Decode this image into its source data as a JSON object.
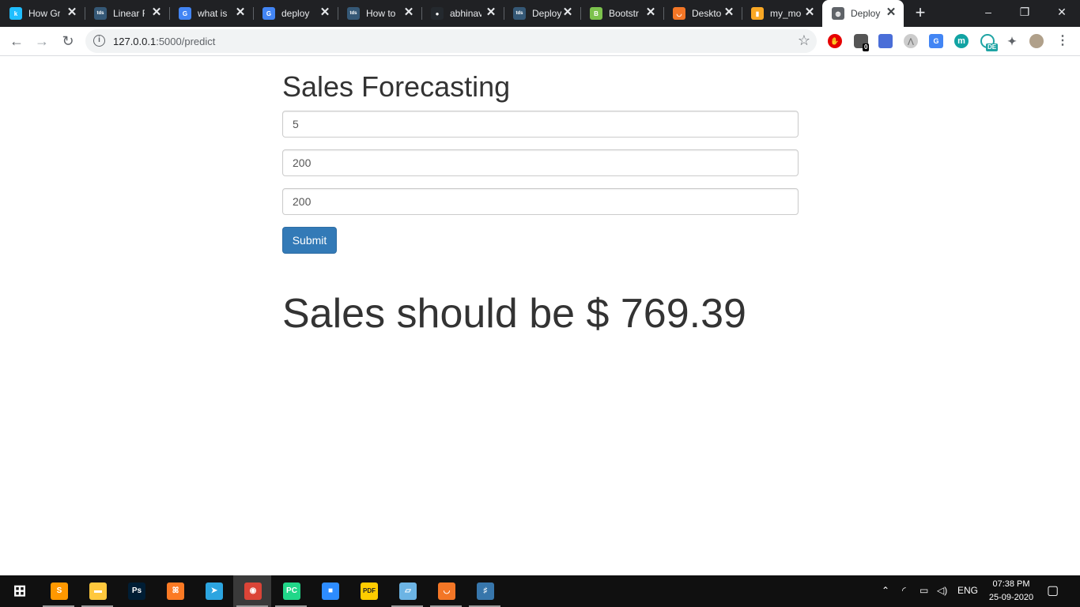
{
  "browser": {
    "tabs": [
      {
        "title": "How Gr",
        "icon": "kaggle-icon",
        "color": "#20beff"
      },
      {
        "title": "Linear R",
        "icon": "tds-icon",
        "color": "#355876"
      },
      {
        "title": "what is",
        "icon": "google-icon",
        "color": "#4285f4"
      },
      {
        "title": "deploy",
        "icon": "google-icon",
        "color": "#4285f4"
      },
      {
        "title": "How to",
        "icon": "tds-icon",
        "color": "#355876"
      },
      {
        "title": "abhinav",
        "icon": "github-icon",
        "color": "#24292e"
      },
      {
        "title": "Deploy",
        "icon": "tds-icon",
        "color": "#355876"
      },
      {
        "title": "Bootstr",
        "icon": "bootstrap-icon",
        "color": "#7cc24d"
      },
      {
        "title": "Deskto",
        "icon": "jupyter-icon",
        "color": "#f37626"
      },
      {
        "title": "my_mo",
        "icon": "notebook-icon",
        "color": "#f9a825"
      },
      {
        "title": "Deploy",
        "icon": "globe-icon",
        "color": "#5f6368",
        "active": true
      }
    ],
    "tab_icon_text": {
      "kaggle": "k",
      "tds": "tds",
      "google": "G",
      "github": "●",
      "bootstrap": "B",
      "jupyter": "◡",
      "notebook": "▮",
      "globe": "◍"
    },
    "close_glyph": "✕",
    "new_tab_glyph": "+",
    "window_controls": {
      "minimize": "–",
      "maximize": "❐",
      "close": "✕"
    },
    "nav": {
      "back": "←",
      "forward": "→",
      "reload": "↻"
    },
    "url_host": "127.0.0.1",
    "url_path": ":5000/predict",
    "info_glyph": "i",
    "star_glyph": "☆",
    "extensions": {
      "adblock": {
        "glyph": "✋",
        "color": "#e60000"
      },
      "ext_badge_count": "0",
      "ext2_color": "#555555",
      "ext3_color": "#4a6ed8",
      "ext4_color": "#bbbbbb",
      "translate_color": "#4285f4",
      "translate_glyph": "G",
      "mendeley_glyph": "m",
      "mendeley_color": "#11a3a3",
      "de_badge": "DE",
      "de_color": "#1fa4a4",
      "puzzle_glyph": "✦",
      "menu_glyph": "⋮"
    }
  },
  "page": {
    "title": "Sales Forecasting",
    "inputs": [
      {
        "value": "5"
      },
      {
        "value": "200"
      },
      {
        "value": "200"
      }
    ],
    "submit_label": "Submit",
    "result_text": "Sales should be $ 769.39"
  },
  "taskbar": {
    "start_glyph": "⊞",
    "apps": [
      {
        "name": "sublime-text",
        "glyph": "S",
        "color": "#ff9800"
      },
      {
        "name": "file-explorer",
        "glyph": "▬",
        "color": "#ffc83d"
      },
      {
        "name": "photoshop",
        "glyph": "Ps",
        "color": "#001d34"
      },
      {
        "name": "xampp",
        "glyph": "ꕤ",
        "color": "#fb7a24"
      },
      {
        "name": "telegram",
        "glyph": "➤",
        "color": "#2ca5e0"
      },
      {
        "name": "chrome",
        "glyph": "◉",
        "color": "#db4437"
      },
      {
        "name": "pycharm",
        "glyph": "PC",
        "color": "#21d789"
      },
      {
        "name": "zoom",
        "glyph": "■",
        "color": "#2d8cff"
      },
      {
        "name": "pdf-reader",
        "glyph": "PDF",
        "color": "#ffcc00"
      },
      {
        "name": "notepad",
        "glyph": "▱",
        "color": "#6cb4e4"
      },
      {
        "name": "jupyter",
        "glyph": "◡",
        "color": "#f37626"
      },
      {
        "name": "python-idle",
        "glyph": "♯",
        "color": "#3776ab"
      }
    ],
    "tray": {
      "chevron": "⌃",
      "wifi": "◜",
      "battery": "▭",
      "volume": "◁)",
      "language": "ENG",
      "notification": "▢"
    },
    "time": "07:38 PM",
    "date": "25-09-2020"
  }
}
